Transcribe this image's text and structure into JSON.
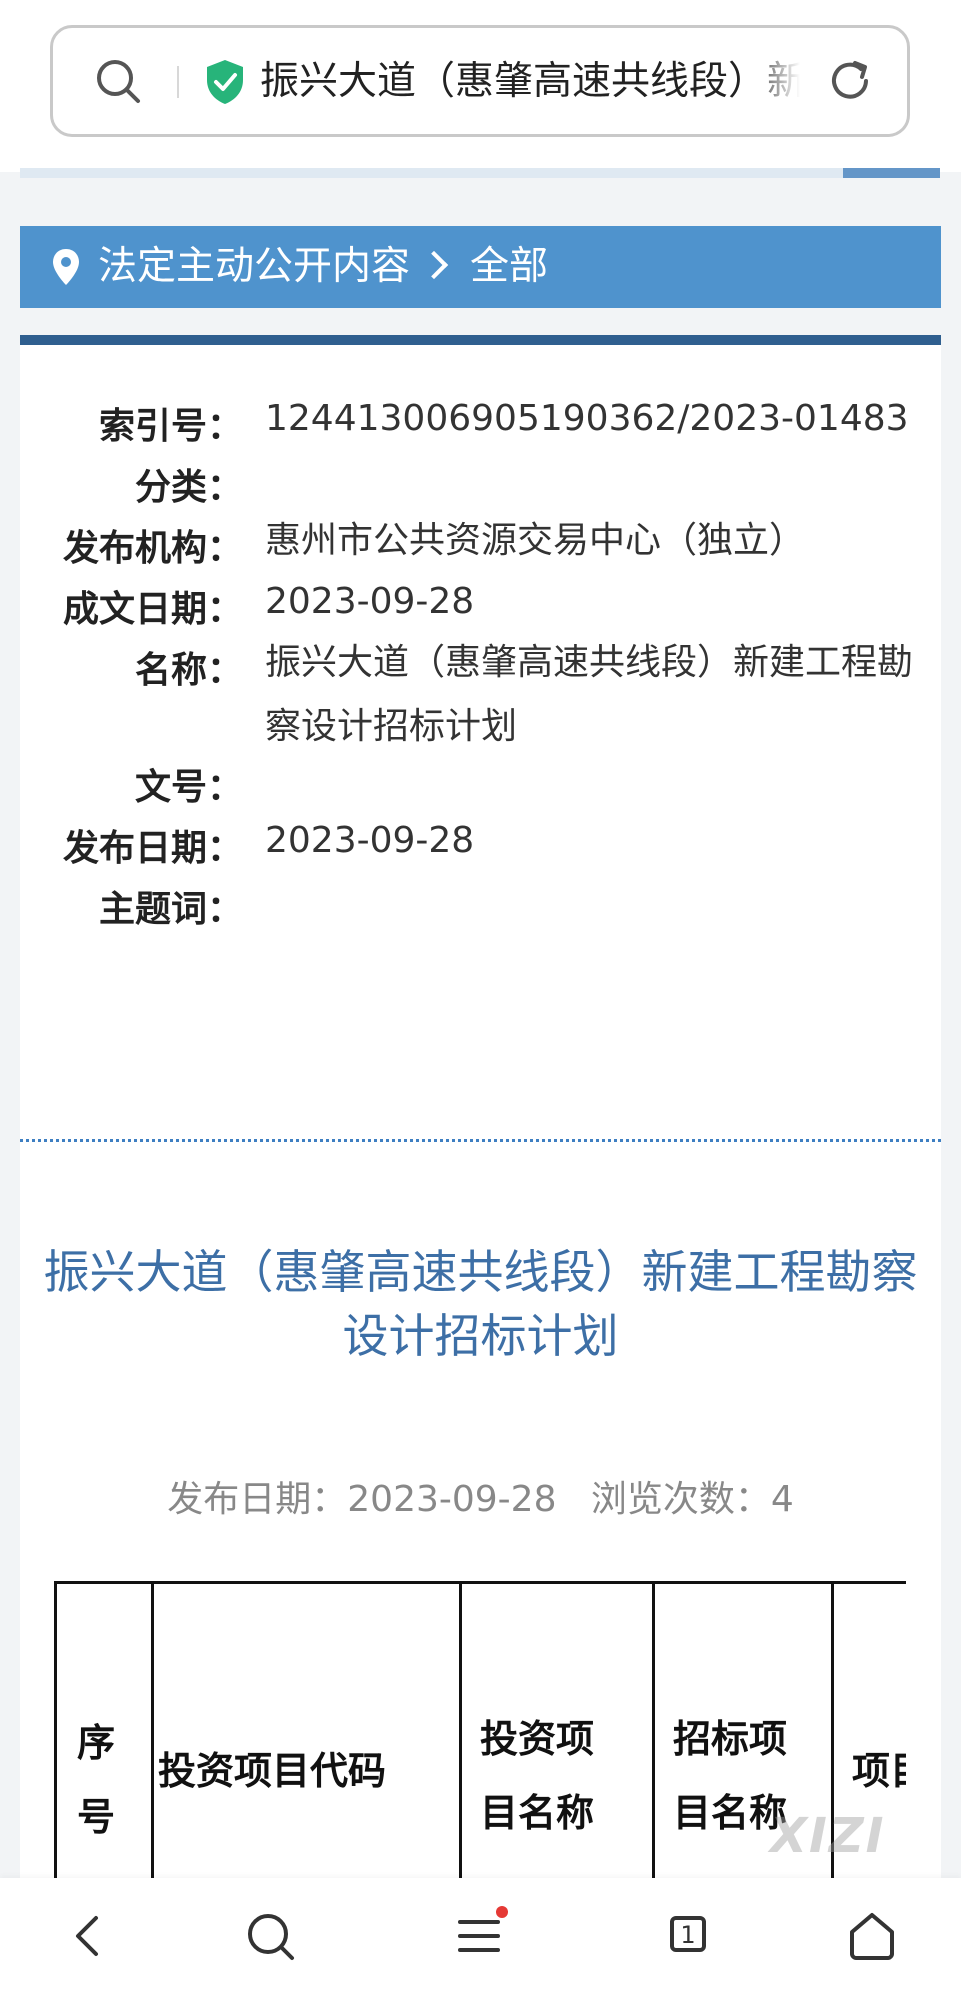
{
  "address_bar": {
    "url_text": "振兴大道（惠肇高速共线段）新建工程勘察设计招标计划",
    "icons": [
      "search-icon",
      "shield-check-icon",
      "reload-icon"
    ]
  },
  "breadcrumb": {
    "section": "法定主动公开内容",
    "current": "全部"
  },
  "metadata": [
    {
      "label": "索引号：",
      "value": "124413006905190362/2023-01483"
    },
    {
      "label": "分类：",
      "value": ""
    },
    {
      "label": "发布机构：",
      "value": "惠州市公共资源交易中心（独立）"
    },
    {
      "label": "成文日期：",
      "value": "2023-09-28"
    },
    {
      "label": "名称：",
      "value": "振兴大道（惠肇高速共线段）新建工程勘察设计招标计划"
    },
    {
      "label": "文号：",
      "value": ""
    },
    {
      "label": "发布日期：",
      "value": "2023-09-28"
    },
    {
      "label": "主题词：",
      "value": ""
    }
  ],
  "document": {
    "title": "振兴大道（惠肇高速共线段）新建工程勘察设计招标计划",
    "publish_label": "发布日期：",
    "publish_date": "2023-09-28",
    "views_label": "浏览次数：",
    "views": "4"
  },
  "table": {
    "headers": [
      "序号",
      "投资项目代码",
      "投资项目名称",
      "招标项目名称",
      "项目"
    ]
  },
  "watermark": "XIZI",
  "bottom_nav": {
    "tab_count": "1",
    "icons": [
      "back-icon",
      "search-icon",
      "menu-icon",
      "tabs-icon",
      "home-icon"
    ]
  },
  "colors": {
    "breadcrumb_bg": "#4f93cd",
    "card_top_border": "#2f5f8f",
    "title_blue": "#3d6fa6",
    "shield_green": "#27b47a",
    "notify_dot": "#e53935"
  }
}
